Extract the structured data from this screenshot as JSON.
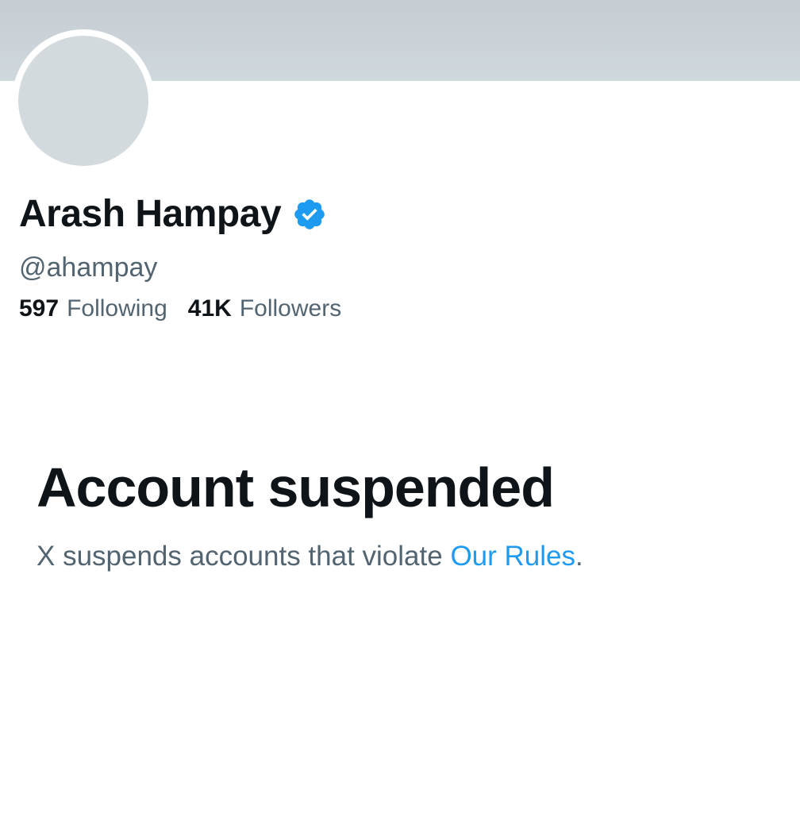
{
  "profile": {
    "display_name": "Arash Hampay",
    "handle": "@ahampay",
    "verified_icon": "verified-badge-icon",
    "stats": {
      "following_count": "597",
      "following_label": "Following",
      "followers_count": "41K",
      "followers_label": "Followers"
    }
  },
  "suspension": {
    "title": "Account suspended",
    "message_prefix": "X suspends accounts that violate ",
    "rules_link": "Our Rules",
    "message_suffix": "."
  },
  "colors": {
    "banner": "#cfd8dd",
    "avatar_placeholder": "#d2dade",
    "text_primary": "#0f1419",
    "text_secondary": "#536471",
    "link": "#1d9bf0",
    "verified": "#1d9bf0"
  }
}
